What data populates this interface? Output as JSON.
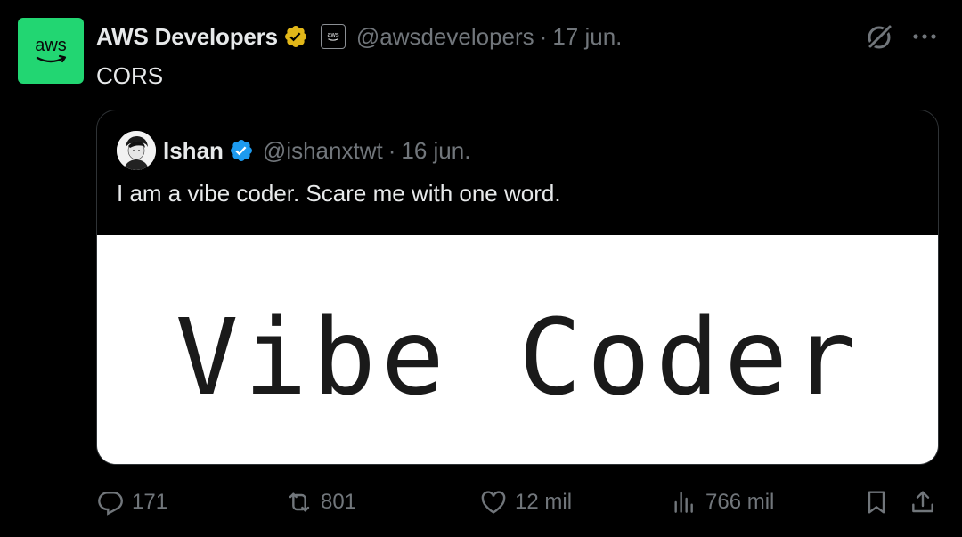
{
  "post": {
    "author_name": "AWS Developers",
    "avatar_text": "aws",
    "affiliate_badge_text": "aws",
    "handle": "@awsdevelopers",
    "separator": "·",
    "date": "17 jun.",
    "text": "CORS"
  },
  "quote": {
    "author_name": "Ishan",
    "handle": "@ishanxtwt",
    "separator": "·",
    "date": "16 jun.",
    "text": "I am a vibe coder. Scare me with one word.",
    "image_text": "Vibe Coder"
  },
  "actions": {
    "replies": "171",
    "reposts": "801",
    "likes": "12 mil",
    "views": "766 mil"
  },
  "colors": {
    "background": "#000000",
    "text_primary": "#e7e9ea",
    "text_secondary": "#71767b",
    "aws_green": "#22d672",
    "verified_gold": "#e2b719",
    "verified_blue": "#1d9bf0",
    "border": "#2f3336"
  },
  "icons": [
    "grok-icon",
    "more-icon",
    "reply-icon",
    "repost-icon",
    "like-icon",
    "views-icon",
    "bookmark-icon",
    "share-icon",
    "verified-gold-icon",
    "verified-blue-icon"
  ]
}
